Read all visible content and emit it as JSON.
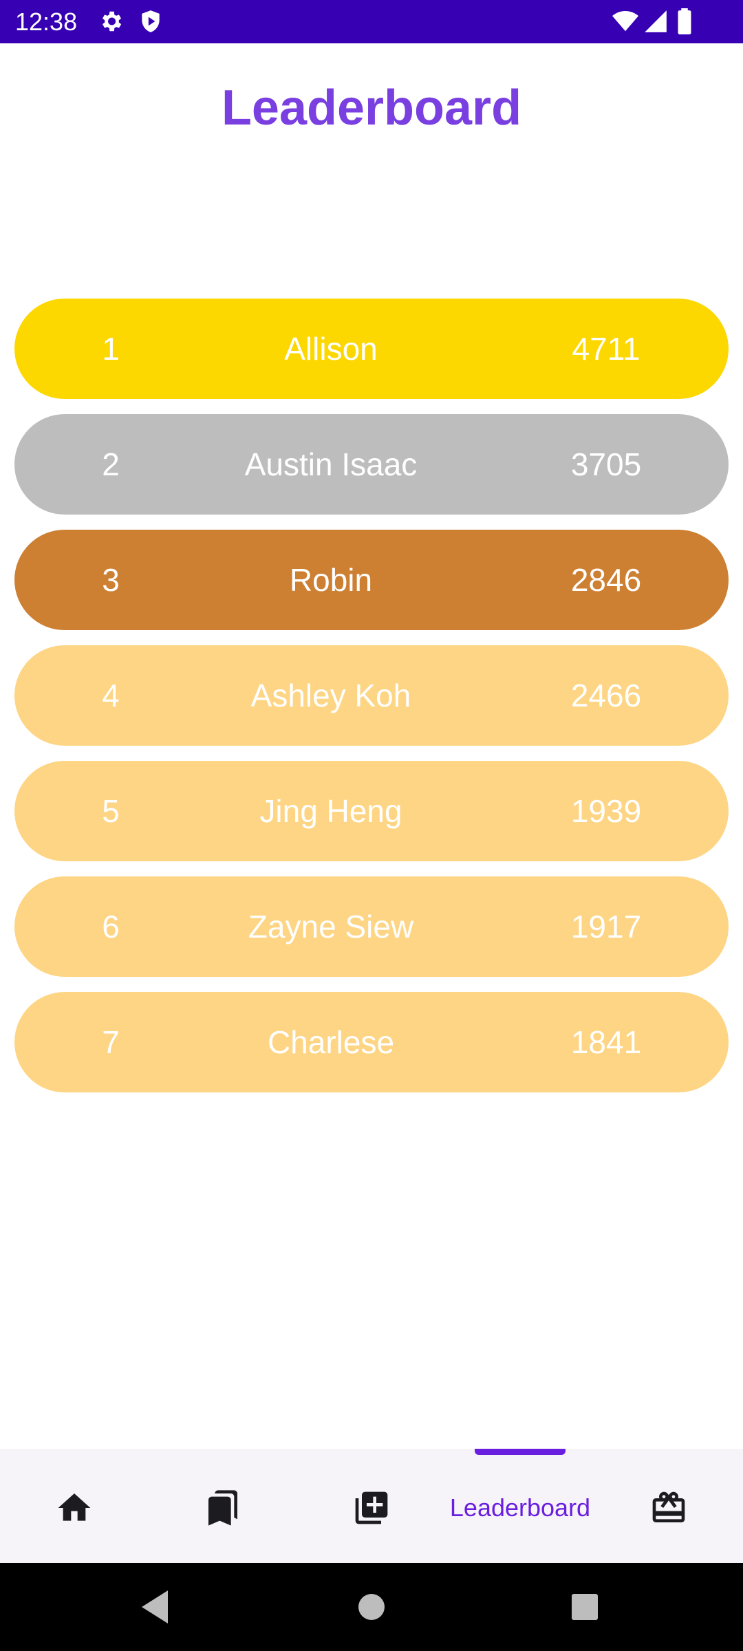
{
  "status_bar": {
    "time": "12:38",
    "left_icons": [
      "settings-icon",
      "shield-icon"
    ],
    "right_icons": [
      "wifi-icon",
      "signal-icon",
      "battery-icon"
    ],
    "background": "#3700b3"
  },
  "page": {
    "title": "Leaderboard",
    "title_color": "#7a3fe0"
  },
  "leaderboard": {
    "rows": [
      {
        "rank": "1",
        "name": "Allison",
        "score": "4711",
        "color": "#fcd700"
      },
      {
        "rank": "2",
        "name": "Austin Isaac",
        "score": "3705",
        "color": "#bdbdbd"
      },
      {
        "rank": "3",
        "name": "Robin",
        "score": "2846",
        "color": "#cd7f32"
      },
      {
        "rank": "4",
        "name": "Ashley Koh",
        "score": "2466",
        "color": "#fdd584"
      },
      {
        "rank": "5",
        "name": "Jing Heng",
        "score": "1939",
        "color": "#fdd584"
      },
      {
        "rank": "6",
        "name": "Zayne Siew",
        "score": "1917",
        "color": "#fdd584"
      },
      {
        "rank": "7",
        "name": "Charlese",
        "score": "1841",
        "color": "#fdd584"
      }
    ]
  },
  "bottom_nav": {
    "items": [
      {
        "icon": "home-icon"
      },
      {
        "icon": "bookmarks-icon"
      },
      {
        "icon": "add-box-icon"
      },
      {
        "label": "Leaderboard",
        "selected": true
      },
      {
        "icon": "redeem-icon"
      }
    ],
    "accent": "#6a1fe0"
  },
  "system_nav": {
    "buttons": [
      "back-icon",
      "home-circle-icon",
      "recents-icon"
    ]
  }
}
